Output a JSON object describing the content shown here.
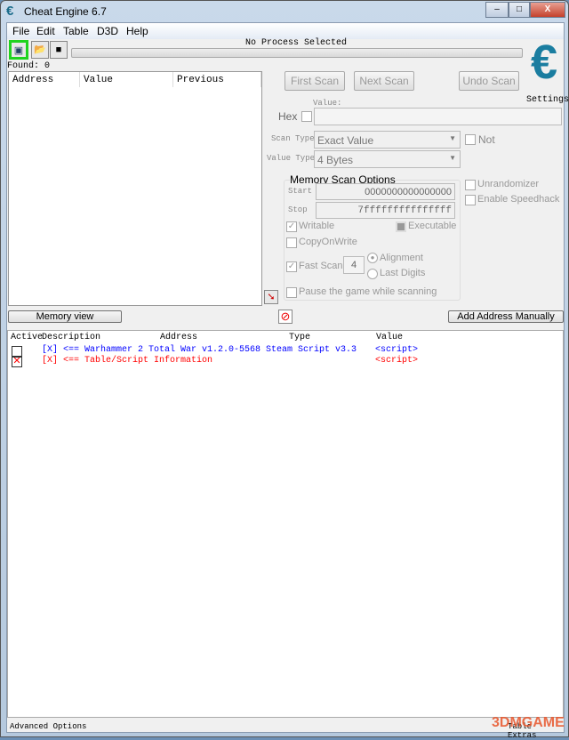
{
  "window": {
    "title": "Cheat Engine 6.7",
    "min": "–",
    "max": "□",
    "close": "X"
  },
  "menu": [
    "File",
    "Edit",
    "Table",
    "D3D",
    "Help"
  ],
  "process": "No Process Selected",
  "found": "Found: 0",
  "scanlist": {
    "columns": [
      "Address",
      "Value",
      "Previous"
    ]
  },
  "buttons": {
    "first_scan": "First Scan",
    "next_scan": "Next Scan",
    "undo_scan": "Undo Scan",
    "settings": "Settings",
    "memory_view": "Memory view",
    "add_address": "Add Address Manually"
  },
  "scan": {
    "value_label": "Value:",
    "hex": "Hex",
    "scan_type_label": "Scan Type",
    "scan_type": "Exact Value",
    "value_type_label": "Value Type",
    "value_type": "4 Bytes",
    "not": "Not"
  },
  "memory_options": {
    "title": "Memory Scan Options",
    "start_label": "Start",
    "start": "0000000000000000",
    "stop_label": "Stop",
    "stop": "7fffffffffffffff",
    "writable": "Writable",
    "executable": "Executable",
    "copyonwrite": "CopyOnWrite",
    "fast_scan": "Fast Scan",
    "fast_scan_value": "4",
    "alignment": "Alignment",
    "last_digits": "Last Digits",
    "pause": "Pause the game while scanning"
  },
  "extras": {
    "unrandomizer": "Unrandomizer",
    "speedhack": "Enable Speedhack"
  },
  "addresslist": {
    "columns": [
      "Active",
      "Description",
      "Address",
      "Type",
      "Value"
    ],
    "rows": [
      {
        "active": false,
        "description": "[X] <== Warhammer 2 Total War v1.2.0-5568 Steam Script v3.3",
        "value": "<script>",
        "color": "#0000ff"
      },
      {
        "active": true,
        "description": "[X] <== Table/Script Information",
        "value": "<script>",
        "color": "#ff0000"
      }
    ]
  },
  "footer": {
    "advanced": "Advanced Options",
    "table_extras": "Table Extras"
  },
  "watermark": "3DMGAME"
}
